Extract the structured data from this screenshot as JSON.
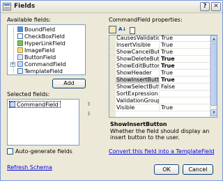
{
  "window": {
    "title": "Fields"
  },
  "titlebar": {
    "help": "?",
    "close": "✕"
  },
  "available": {
    "label": "Available fields:",
    "items": [
      {
        "label": "BoundField"
      },
      {
        "label": "CheckBoxField"
      },
      {
        "label": "HyperLinkField"
      },
      {
        "label": "ImageField"
      },
      {
        "label": "ButtonField"
      },
      {
        "label": "CommandField"
      },
      {
        "label": "TemplateField"
      }
    ],
    "add_label": "Add"
  },
  "selected": {
    "label": "Selected fields:",
    "items": [
      {
        "label": "CommandField"
      }
    ],
    "up": "⬆",
    "down": "⬇",
    "delete": "✕"
  },
  "autogen": {
    "label": "Auto-generate fields"
  },
  "refresh": {
    "label": "Refresh Schema"
  },
  "properties": {
    "label": "CommandField properties:",
    "toolbar": {
      "az": "A↓"
    },
    "rows": [
      {
        "name": "CausesValidation",
        "value": "True",
        "bold": false
      },
      {
        "name": "InsertVisible",
        "value": "True",
        "bold": false
      },
      {
        "name": "ShowCancelButton",
        "value": "True",
        "bold": false
      },
      {
        "name": "ShowDeleteButton",
        "value": "True",
        "bold": true
      },
      {
        "name": "ShowEditButton",
        "value": "True",
        "bold": true
      },
      {
        "name": "ShowHeader",
        "value": "True",
        "bold": false
      },
      {
        "name": "ShowInsertButton",
        "value": "True",
        "bold": true
      },
      {
        "name": "ShowSelectButton",
        "value": "False",
        "bold": false
      },
      {
        "name": "SortExpression",
        "value": "",
        "bold": false
      },
      {
        "name": "ValidationGroup",
        "value": "",
        "bold": false
      },
      {
        "name": "Visible",
        "value": "True",
        "bold": false
      }
    ],
    "selected_row": 6
  },
  "description": {
    "title": "ShowInsertButton",
    "text": "Whether the field should display an insert button to the user."
  },
  "convert": {
    "label": "Convert this field into a TemplateField"
  },
  "buttons": {
    "ok": "OK",
    "cancel": "Cancel"
  },
  "colors": {
    "accent": "#0000e0",
    "selection": "#cfcfcf"
  }
}
